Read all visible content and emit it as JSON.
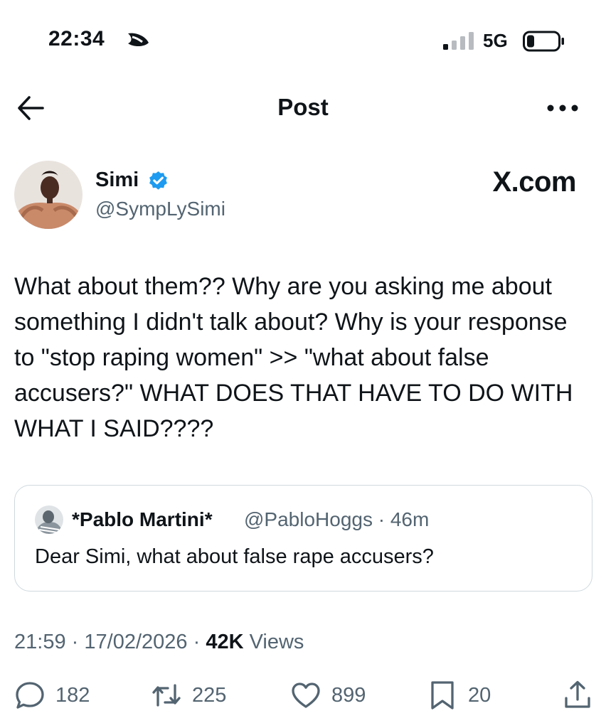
{
  "status_bar": {
    "time": "22:34",
    "network": "5G"
  },
  "header": {
    "title": "Post"
  },
  "author": {
    "name": "Simi",
    "handle": "@SympLySimi",
    "source_label": "X.com"
  },
  "tweet": {
    "text": "What about them?? Why are you asking me about something I didn't talk about? Why is your response to \"stop raping women\" >> \"what about false accusers?\" WHAT DOES THAT HAVE TO DO WITH WHAT I SAID????",
    "time": "21:59",
    "date": "17/02/2026",
    "views_count": "42K",
    "views_label": "Views",
    "separator": "·"
  },
  "quote": {
    "name": "*Pablo Martini*",
    "handle_time": "@PabloHoggs · 46m",
    "text": "Dear Simi, what about false rape accusers?"
  },
  "actions": {
    "replies": "182",
    "reposts": "225",
    "likes": "899",
    "bookmarks": "20"
  },
  "icons": [
    "moon-icon",
    "signal-icon",
    "battery-icon",
    "back-icon",
    "more-icon",
    "verified-icon",
    "reply-icon",
    "repost-icon",
    "like-icon",
    "bookmark-icon",
    "share-icon"
  ],
  "colors": {
    "text": "#0f1419",
    "secondary": "#536471",
    "verified": "#1d9bf0",
    "border": "#cfd9de"
  }
}
